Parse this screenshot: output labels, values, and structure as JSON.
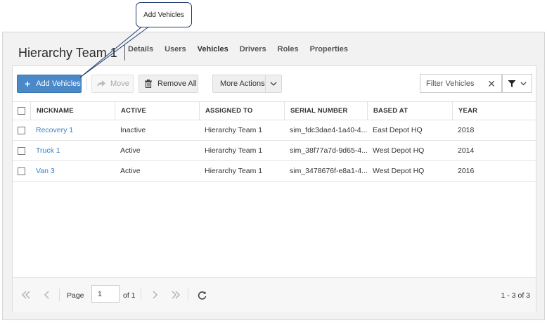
{
  "callout": {
    "text": "Add Vehicles"
  },
  "header": {
    "title": "Hierarchy Team 1"
  },
  "tabs": [
    {
      "label": "Details"
    },
    {
      "label": "Users"
    },
    {
      "label": "Vehicles",
      "active": true
    },
    {
      "label": "Drivers"
    },
    {
      "label": "Roles"
    },
    {
      "label": "Properties"
    }
  ],
  "toolbar": {
    "add_label": "Add Vehicles",
    "move_label": "Move",
    "remove_label": "Remove All",
    "more_label": "More Actions",
    "filter_placeholder": "Filter Vehicles"
  },
  "table": {
    "columns": [
      "NICKNAME",
      "ACTIVE",
      "ASSIGNED TO",
      "SERIAL NUMBER",
      "BASED AT",
      "YEAR"
    ],
    "rows": [
      {
        "nickname": "Recovery 1",
        "active": "Inactive",
        "assigned_to": "Hierarchy Team 1",
        "serial": "sim_fdc3dae4-1a40-4...",
        "based_at": "East Depot HQ",
        "year": "2018"
      },
      {
        "nickname": "Truck 1",
        "active": "Active",
        "assigned_to": "Hierarchy Team 1",
        "serial": "sim_38f77a7d-9d65-4...",
        "based_at": "West Depot HQ",
        "year": "2014"
      },
      {
        "nickname": "Van 3",
        "active": "Active",
        "assigned_to": "Hierarchy Team 1",
        "serial": "sim_3478676f-e8a1-4...",
        "based_at": "West Depot HQ",
        "year": "2016"
      }
    ]
  },
  "pager": {
    "page_label": "Page",
    "page_value": "1",
    "of_label": "of 1",
    "info": "1 - 3 of 3"
  },
  "colors": {
    "accent": "#4a88c8",
    "link": "#3a7fc1"
  }
}
